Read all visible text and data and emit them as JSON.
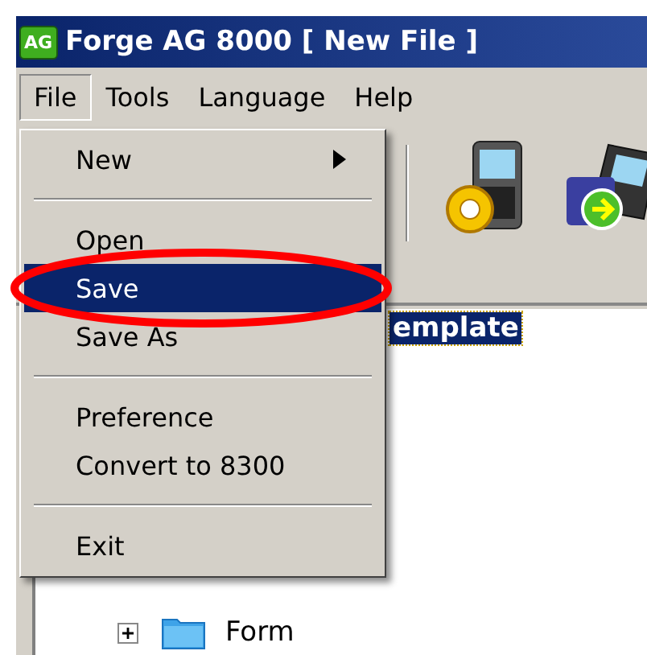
{
  "window": {
    "logo": "AG",
    "title": "Forge AG 8000 [ New File ]"
  },
  "menu_bar": [
    {
      "label": "File",
      "selected": true
    },
    {
      "label": "Tools",
      "selected": false
    },
    {
      "label": "Language",
      "selected": false
    },
    {
      "label": "Help",
      "selected": false
    }
  ],
  "file_menu": [
    {
      "kind": "item",
      "label": "New",
      "submenu": true,
      "selected": false
    },
    {
      "kind": "separator"
    },
    {
      "kind": "item",
      "label": "Open",
      "submenu": false,
      "selected": false
    },
    {
      "kind": "item",
      "label": "Save",
      "submenu": false,
      "selected": true
    },
    {
      "kind": "item",
      "label": "Save As",
      "submenu": false,
      "selected": false
    },
    {
      "kind": "separator"
    },
    {
      "kind": "item",
      "label": "Preference",
      "submenu": false,
      "selected": false
    },
    {
      "kind": "item",
      "label": "Convert to 8300",
      "submenu": false,
      "selected": false
    },
    {
      "kind": "separator"
    },
    {
      "kind": "item",
      "label": "Exit",
      "submenu": false,
      "selected": false
    }
  ],
  "toolbar": [
    {
      "kind": "gear-device"
    },
    {
      "kind": "camera-device"
    }
  ],
  "tree": [
    {
      "label": "emplate",
      "selected": true
    },
    {
      "label": "Form",
      "selected": false,
      "expanded": false
    }
  ]
}
